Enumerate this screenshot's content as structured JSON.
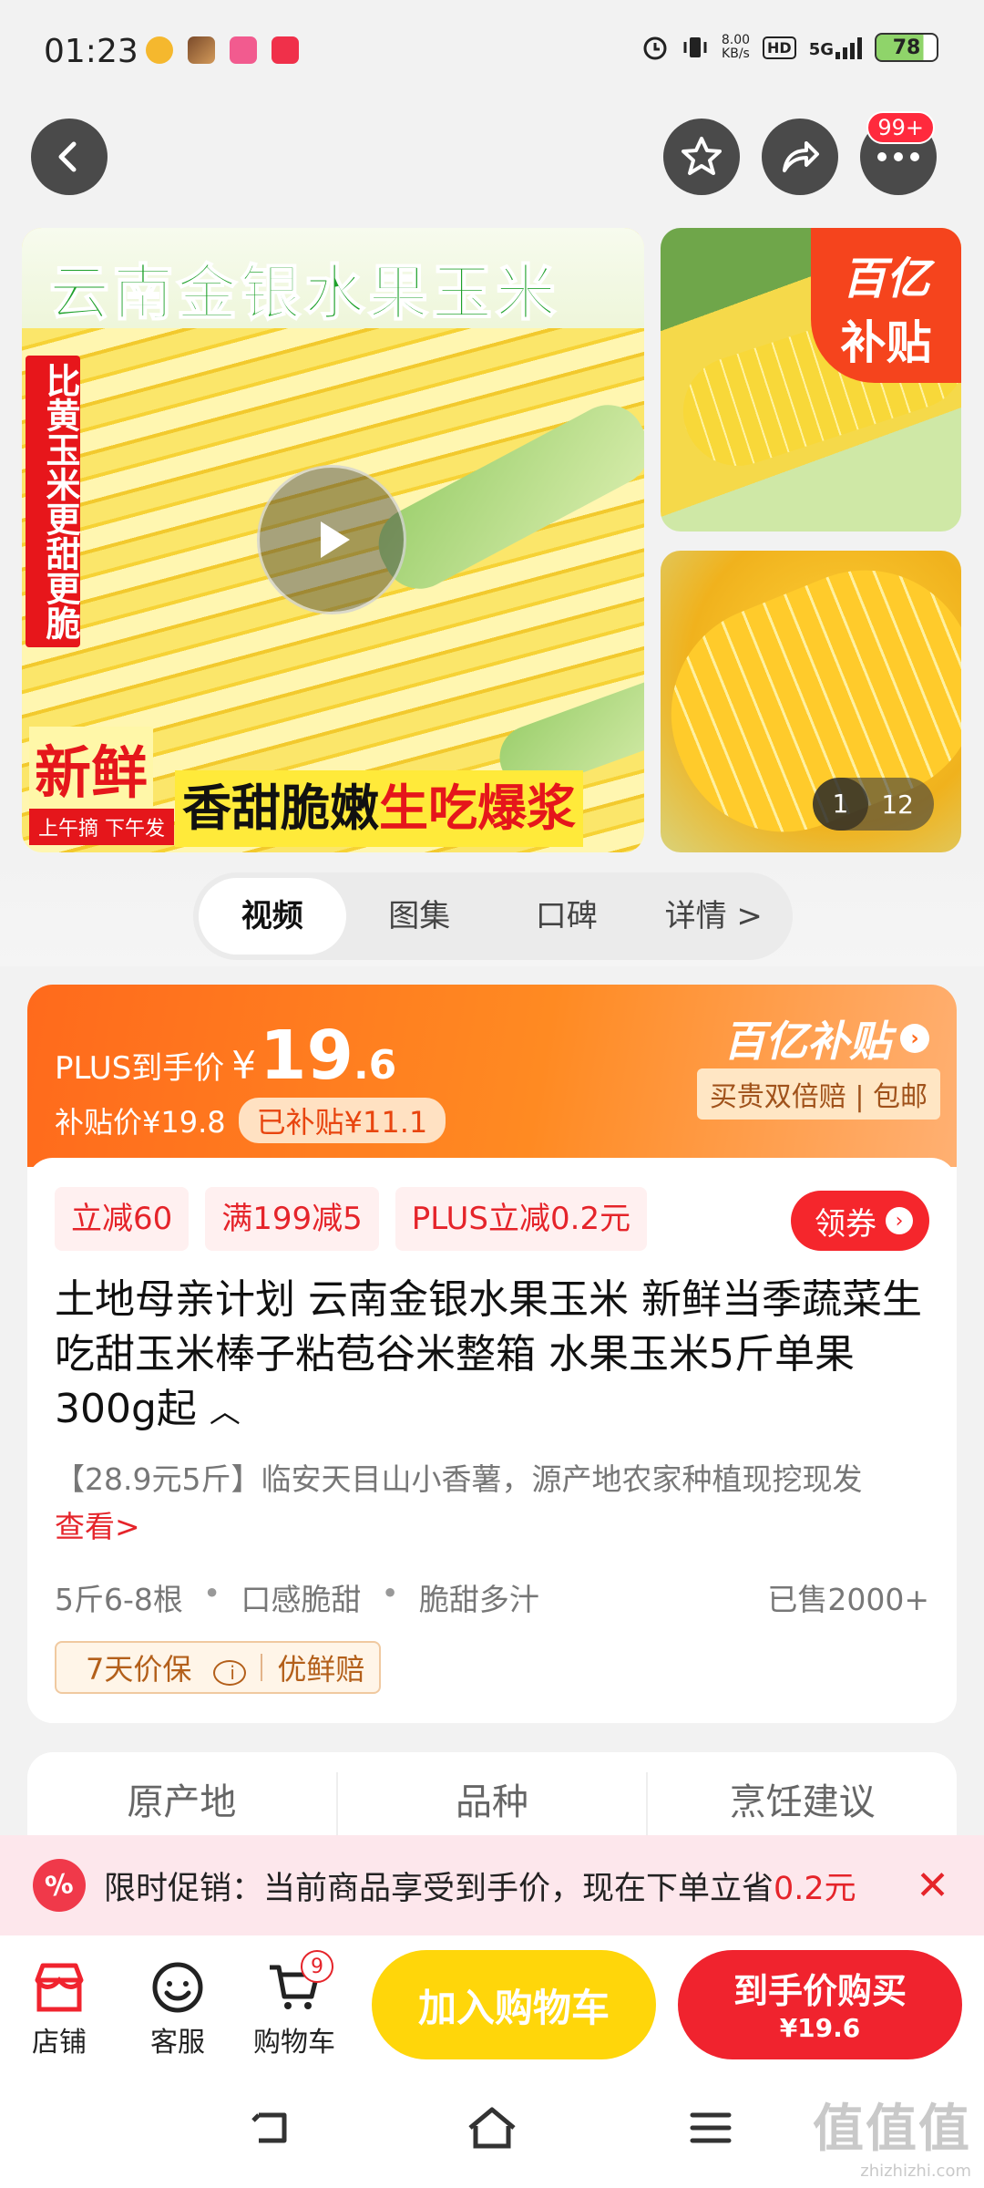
{
  "status_bar": {
    "time": "01:23",
    "net_speed_value": "8.00",
    "net_speed_unit": "KB/s",
    "hd": "HD",
    "network": "5G",
    "battery": "78"
  },
  "top_nav": {
    "more_badge": "99+"
  },
  "gallery": {
    "main_title": "云南金银水果玉米",
    "vertical_text": "比黄玉米更甜更脆",
    "fresh": "新鲜",
    "fresh_sub": "上午摘 下午发",
    "slogan_black": "香甜脆嫩",
    "slogan_red": "生吃爆浆",
    "subsidy_tag_line1": "百亿",
    "subsidy_tag_line2": "补贴",
    "counter_current": "1",
    "counter_total": "12"
  },
  "tabs": [
    {
      "label": "视频",
      "active": true
    },
    {
      "label": "图集",
      "active": false
    },
    {
      "label": "口碑",
      "active": false
    },
    {
      "label": "详情 >",
      "active": false
    }
  ],
  "price": {
    "plus_label": "PLUS到手价",
    "currency": "¥",
    "price_int": "19",
    "price_dec": ".6",
    "subsidy_price_label": "补贴价¥19.8",
    "subsidized_chip": "已补贴¥11.1",
    "subsidy_logo": "百亿补贴",
    "compensation": "买贵双倍赔 | 包邮"
  },
  "coupons": [
    "立减60",
    "满199减5",
    "PLUS立减0.2元"
  ],
  "get_coupon_label": "领券",
  "product": {
    "title": "土地母亲计划 云南金银水果玉米 新鲜当季蔬菜生吃甜玉米棒子粘苞谷米整箱 水果玉米5斤单果300g起",
    "title_caret": "︿",
    "promo_text": "【28.9元5斤】临安天目山小香薯，源产地农家种植现挖现发",
    "see_more": "查看>",
    "attributes": [
      "5斤6-8根",
      "口感脆甜",
      "脆甜多汁"
    ],
    "sold": "已售2000+",
    "guarantee_1": "7天价保",
    "guarantee_2": "优鲜赔"
  },
  "origin_card": {
    "cols": [
      "原产地",
      "品种",
      "烹饪建议"
    ]
  },
  "promo_banner": {
    "text_black": "限时促销：当前商品享受到手价，现在下单立省",
    "text_red": "0.2元",
    "icon": "%"
  },
  "action_bar": {
    "shop": "店铺",
    "service": "客服",
    "cart": "购物车",
    "cart_count": "9",
    "add_to_cart": "加入购物车",
    "buy_line1": "到手价购买",
    "buy_line2": "¥19.6"
  },
  "watermark": {
    "line1": "值值值",
    "line2": "zhizhizhi.com"
  }
}
